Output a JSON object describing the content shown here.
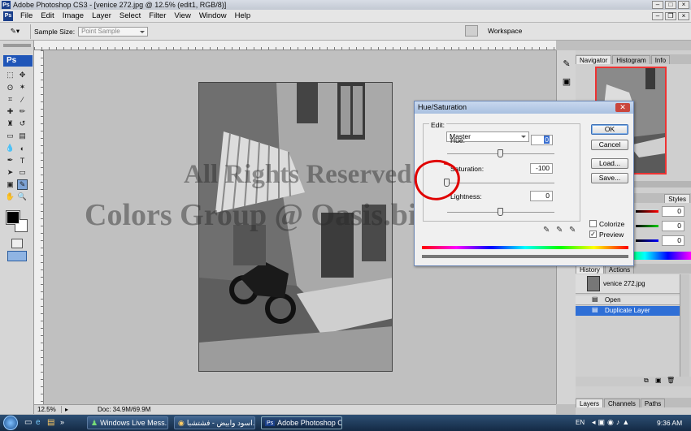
{
  "window": {
    "title": "Adobe Photoshop CS3 - [venice 272.jpg @ 12.5% (edit1, RGB/8)]"
  },
  "menu": [
    "File",
    "Edit",
    "Image",
    "Layer",
    "Select",
    "Filter",
    "View",
    "Window",
    "Help"
  ],
  "options": {
    "sample_size_label": "Sample Size:",
    "sample_size_value": "Point Sample",
    "workspace_label": "Workspace"
  },
  "app_logo": "Ps",
  "watermark": {
    "line1": "All Rights Reserved to",
    "line2": "Colors Group @ Oasis.bindubai.com"
  },
  "status": {
    "zoom": "12.5%",
    "doc": "Doc: 34.9M/69.9M"
  },
  "dialog": {
    "title": "Hue/Saturation",
    "edit_label": "Edit:",
    "edit_value": "Master",
    "hue_label": "Hue:",
    "hue_value": "0",
    "saturation_label": "Saturation:",
    "saturation_value": "-100",
    "lightness_label": "Lightness:",
    "lightness_value": "0",
    "ok": "OK",
    "cancel": "Cancel",
    "load": "Load...",
    "save": "Save...",
    "colorize_label": "Colorize",
    "colorize_checked": false,
    "preview_label": "Preview",
    "preview_checked": true,
    "slider_levels": {
      "hue": 0.5,
      "saturation": 0.0,
      "lightness": 0.5
    }
  },
  "panels": {
    "nav_tabs": [
      "Navigator",
      "Histogram",
      "Info"
    ],
    "color_tabs": [
      "Styles"
    ],
    "color_values": [
      "0",
      "0",
      "0"
    ],
    "history_tabs": [
      "History",
      "Actions"
    ],
    "history_snapshot": "venice 272.jpg",
    "history_items": [
      "Open",
      "Duplicate Layer"
    ],
    "layers_tabs": [
      "Layers",
      "Channels",
      "Paths"
    ]
  },
  "taskbar": {
    "items": [
      "Windows Live Mess...",
      "اسود وابيض - فشتشبا...",
      "Adobe Photoshop C..."
    ],
    "lang": "EN",
    "time": "9:36 AM"
  },
  "colors": {
    "accent": "#2f6fd6",
    "annotation": "#e00000"
  }
}
